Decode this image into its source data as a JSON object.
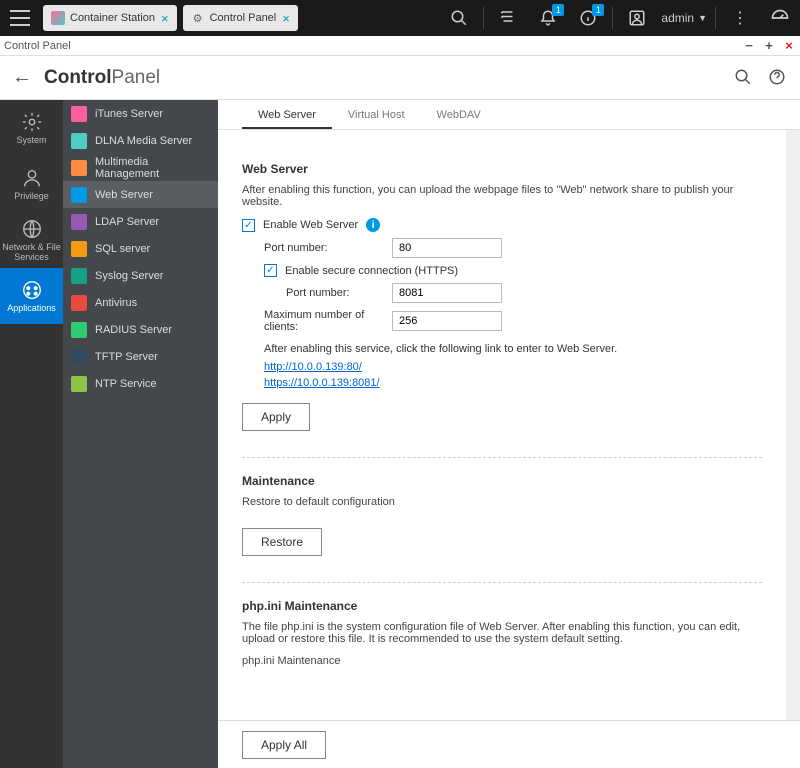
{
  "topbar": {
    "tabs": [
      {
        "label": "Container Station"
      },
      {
        "label": "Control Panel"
      }
    ],
    "badge_notif": "1",
    "badge_info": "1",
    "admin": "admin"
  },
  "window": {
    "title": "Control Panel"
  },
  "header": {
    "title_bold": "Control",
    "title_light": "Panel"
  },
  "rail": [
    {
      "label": "System"
    },
    {
      "label": "Privilege"
    },
    {
      "label": "Network & File Services"
    },
    {
      "label": "Applications"
    }
  ],
  "sidemenu": [
    {
      "label": "iTunes Server"
    },
    {
      "label": "DLNA Media Server"
    },
    {
      "label": "Multimedia Management"
    },
    {
      "label": "Web Server"
    },
    {
      "label": "LDAP Server"
    },
    {
      "label": "SQL server"
    },
    {
      "label": "Syslog Server"
    },
    {
      "label": "Antivirus"
    },
    {
      "label": "RADIUS Server"
    },
    {
      "label": "TFTP Server"
    },
    {
      "label": "NTP Service"
    }
  ],
  "ctabs": [
    {
      "label": "Web Server"
    },
    {
      "label": "Virtual Host"
    },
    {
      "label": "WebDAV"
    }
  ],
  "webserver": {
    "title": "Web Server",
    "desc": "After enabling this function, you can upload the webpage files to \"Web\" network share to publish your website.",
    "enable_label": "Enable Web Server",
    "port_label": "Port number:",
    "port_value": "80",
    "https_label": "Enable secure connection (HTTPS)",
    "https_port_label": "Port number:",
    "https_port_value": "8081",
    "maxclients_label": "Maximum number of clients:",
    "maxclients_value": "256",
    "after_desc": "After enabling this service, click the following link to enter to Web Server.",
    "link1": "http://10.0.0.139:80/",
    "link2": "https://10.0.0.139:8081/",
    "apply": "Apply"
  },
  "maintenance": {
    "title": "Maintenance",
    "desc": "Restore to default configuration",
    "restore": "Restore"
  },
  "phpini": {
    "title": "php.ini Maintenance",
    "desc": "The file php.ini is the system configuration file of Web Server. After enabling this function, you can edit, upload or restore this file. It is recommended to use the system default setting.",
    "sub": "php.ini Maintenance"
  },
  "footer": {
    "apply_all": "Apply All"
  }
}
